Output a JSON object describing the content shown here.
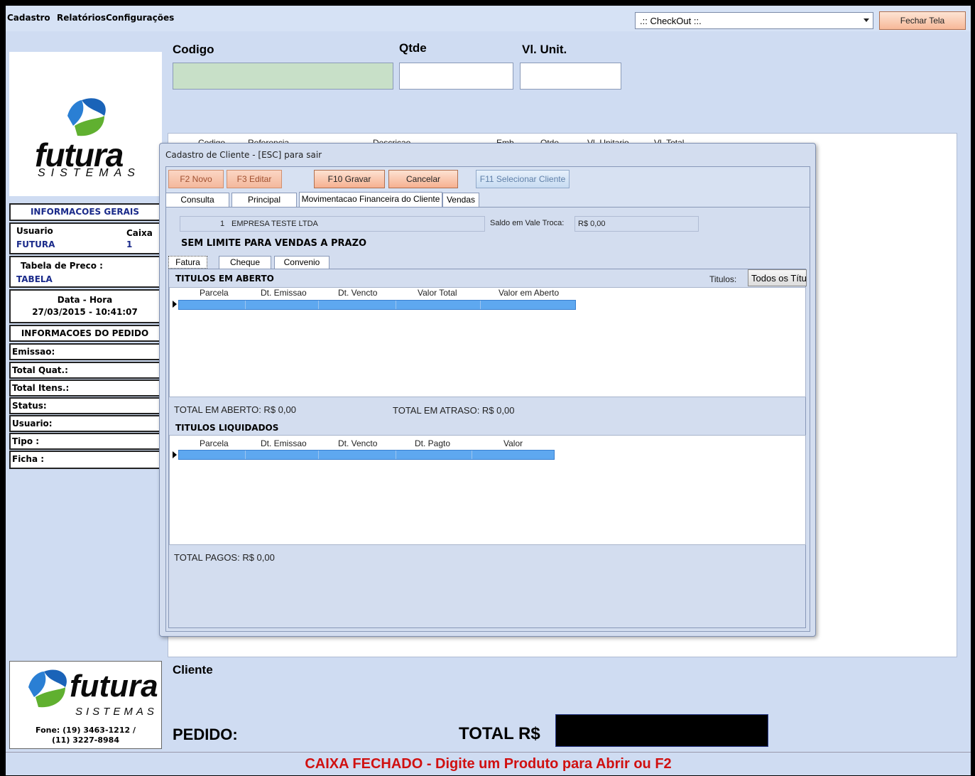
{
  "menu": {
    "items": [
      "Cadastro",
      "Relatórios",
      "Configurações"
    ]
  },
  "checkout_select": {
    "value": ".:: CheckOut ::."
  },
  "close_button": {
    "label": "Fechar Tela"
  },
  "logo": {
    "brand": "futura",
    "sub": "SISTEMAS"
  },
  "info_geral": {
    "title": "INFORMACOES GERAIS",
    "usuario_label": "Usuario",
    "usuario_value": "FUTURA",
    "caixa_label": "Caixa",
    "caixa_value": "1",
    "tabela_label": "Tabela de Preco :",
    "tabela_value": "TABELA",
    "datahora_label": "Data - Hora",
    "datahora_value": "27/03/2015 - 10:41:07"
  },
  "info_pedido": {
    "title": "INFORMACOES DO PEDIDO",
    "fields": [
      "Emissao:",
      "Total Quat.:",
      "Total Itens.:",
      "Status:",
      "Usuario:",
      "Tipo :",
      "Ficha :"
    ]
  },
  "footer_logo": {
    "phone": "Fone: (19) 3463-1212 /",
    "phone2": "(11) 3227-8984"
  },
  "entry": {
    "codigo_label": "Codigo",
    "qtde_label": "Qtde",
    "vlunit_label": "Vl. Unit."
  },
  "grid_headers": [
    "Codigo",
    "Referencia",
    "Descricao",
    "Emb",
    "Qtde",
    "Vl. Unitario",
    "Vl. Total"
  ],
  "bottom": {
    "cliente_label": "Cliente",
    "pedido_label": "PEDIDO:",
    "total_label": "TOTAL R$"
  },
  "status": {
    "message": "CAIXA FECHADO - Digite um Produto para Abrir ou F2"
  },
  "dialog": {
    "title": "Cadastro de Cliente - [ESC] para sair",
    "buttons": {
      "novo": "F2 Novo",
      "editar": "F3 Editar",
      "gravar": "F10 Gravar",
      "cancelar": "Cancelar",
      "selecionar": "F11 Selecionar Cliente"
    },
    "tabs": [
      "Consulta",
      "Principal",
      "Movimentacao Financeira do Cliente",
      "Vendas"
    ],
    "client_code": "1",
    "client_name": "EMPRESA TESTE LTDA",
    "saldo_label": "Saldo em Vale Troca:",
    "saldo_value": "R$ 0,00",
    "sem_limite": "SEM LIMITE PARA VENDAS A PRAZO",
    "subtabs": [
      "Fatura",
      "Cheque",
      "Convenio"
    ],
    "abertos_title": "TITULOS EM ABERTO",
    "titulos_label": "Titulos:",
    "titulos_value": "Todos os Títu",
    "abertos_headers": [
      "Parcela",
      "Dt. Emissao",
      "Dt. Vencto",
      "Valor Total",
      "Valor em Aberto"
    ],
    "total_aberto": "TOTAL EM ABERTO: R$ 0,00",
    "total_atraso": "TOTAL EM ATRASO: R$ 0,00",
    "liquidados_title": "TITULOS LIQUIDADOS",
    "liquidados_headers": [
      "Parcela",
      "Dt. Emissao",
      "Dt. Vencto",
      "Dt. Pagto",
      "Valor"
    ],
    "total_pagos": "TOTAL PAGOS: R$ 0,00"
  },
  "colors": {
    "panel": "#cfdcf2",
    "status_text": "#d01010",
    "selection": "#5ea8f0"
  }
}
